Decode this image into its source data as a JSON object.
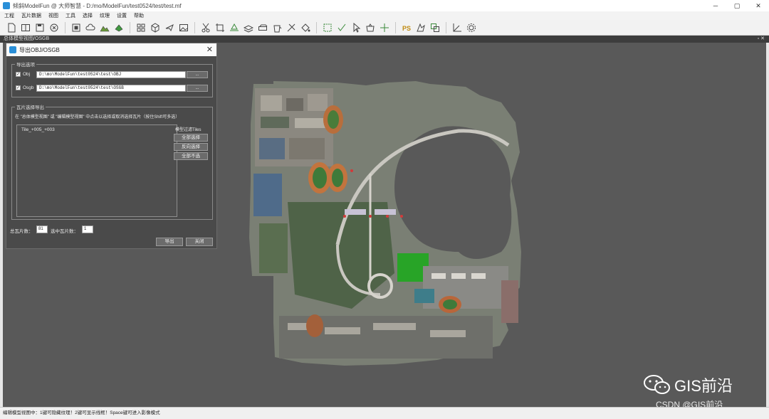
{
  "window": {
    "title": "倾斜ModelFun @ 大师智慧 - D:/mo/ModelFun/test0524/test/test.mf",
    "controls": [
      "─",
      "▢",
      "✕"
    ]
  },
  "menu": [
    "工程",
    "瓦片数据",
    "视图",
    "工具",
    "选择",
    "纹理",
    "设置",
    "帮助"
  ],
  "view": {
    "header": "总体模型视图/OSGB",
    "header_controls": "▫ ✕"
  },
  "dialog": {
    "title": "导出OBJ/OSGB",
    "close": "✕",
    "export_options_legend": "导出选项",
    "obj": {
      "checked": true,
      "label": "Obj",
      "path": "D:\\mo\\ModelFun\\test0524\\test\\OBJ",
      "browse": "..."
    },
    "osgb": {
      "checked": true,
      "label": "Osgb",
      "path": "D:\\mo\\ModelFun\\test0524\\test\\OSGB",
      "browse": "..."
    },
    "tile_legend": "瓦片选择导出",
    "tile_hint": "在 \"总体模型视图\" 或 \"编辑模型视图\" 中点击以选择或取消选择瓦片（按住Shift可多选）",
    "tiles": [
      "Tile_+005_+003"
    ],
    "side_label": "模型过滤Tiles",
    "select_all": "全部选择",
    "invert_select": "反向选择",
    "select_none": "全部不选",
    "total_tiles_label": "总瓦片数：",
    "total_tiles_value": "81",
    "selected_tiles_label": "选中瓦片数：",
    "selected_tiles_value": "1",
    "export_button": "导出",
    "close_button": "关闭"
  },
  "statusbar": "编辑模型视图中：1键可隐藏纹理！2键可显示线框！Space键可进入影像模式",
  "watermark": {
    "brand": "GIS前沿",
    "csdn": "CSDN @GIS前沿"
  },
  "colors": {
    "viewport_bg": "#595959",
    "dialog_bg": "#4a4a4a",
    "selected_tile": "#1fa81f",
    "accent": "#2a8fd8"
  }
}
